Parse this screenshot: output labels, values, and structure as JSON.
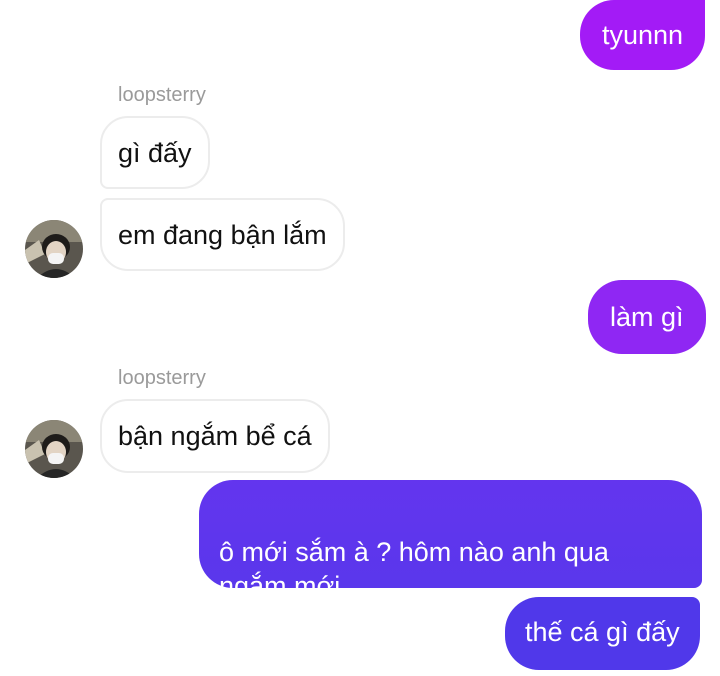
{
  "messages": [
    {
      "text": "tyunnn",
      "direction": "outgoing"
    },
    {
      "sender": "loopsterry"
    },
    {
      "text": "gì đấy",
      "direction": "incoming"
    },
    {
      "text": "em đang bận lắm",
      "direction": "incoming"
    },
    {
      "text": "làm gì",
      "direction": "outgoing"
    },
    {
      "sender": "loopsterry"
    },
    {
      "text": "bận ngắm bể cá",
      "direction": "incoming"
    },
    {
      "text": "ô mới sắm à ? hôm nào anh qua\nngắm mới",
      "direction": "outgoing"
    },
    {
      "text": "thế cá gì đấy",
      "direction": "outgoing"
    }
  ],
  "colors": {
    "outgoing_top": "#a31bf6",
    "outgoing_mid": "#7a30f0",
    "outgoing_bottom": "#5038ea",
    "incoming_bg": "#ffffff",
    "incoming_border": "#ececec"
  },
  "icons": {
    "avatar": "user-avatar-photo-icon"
  }
}
